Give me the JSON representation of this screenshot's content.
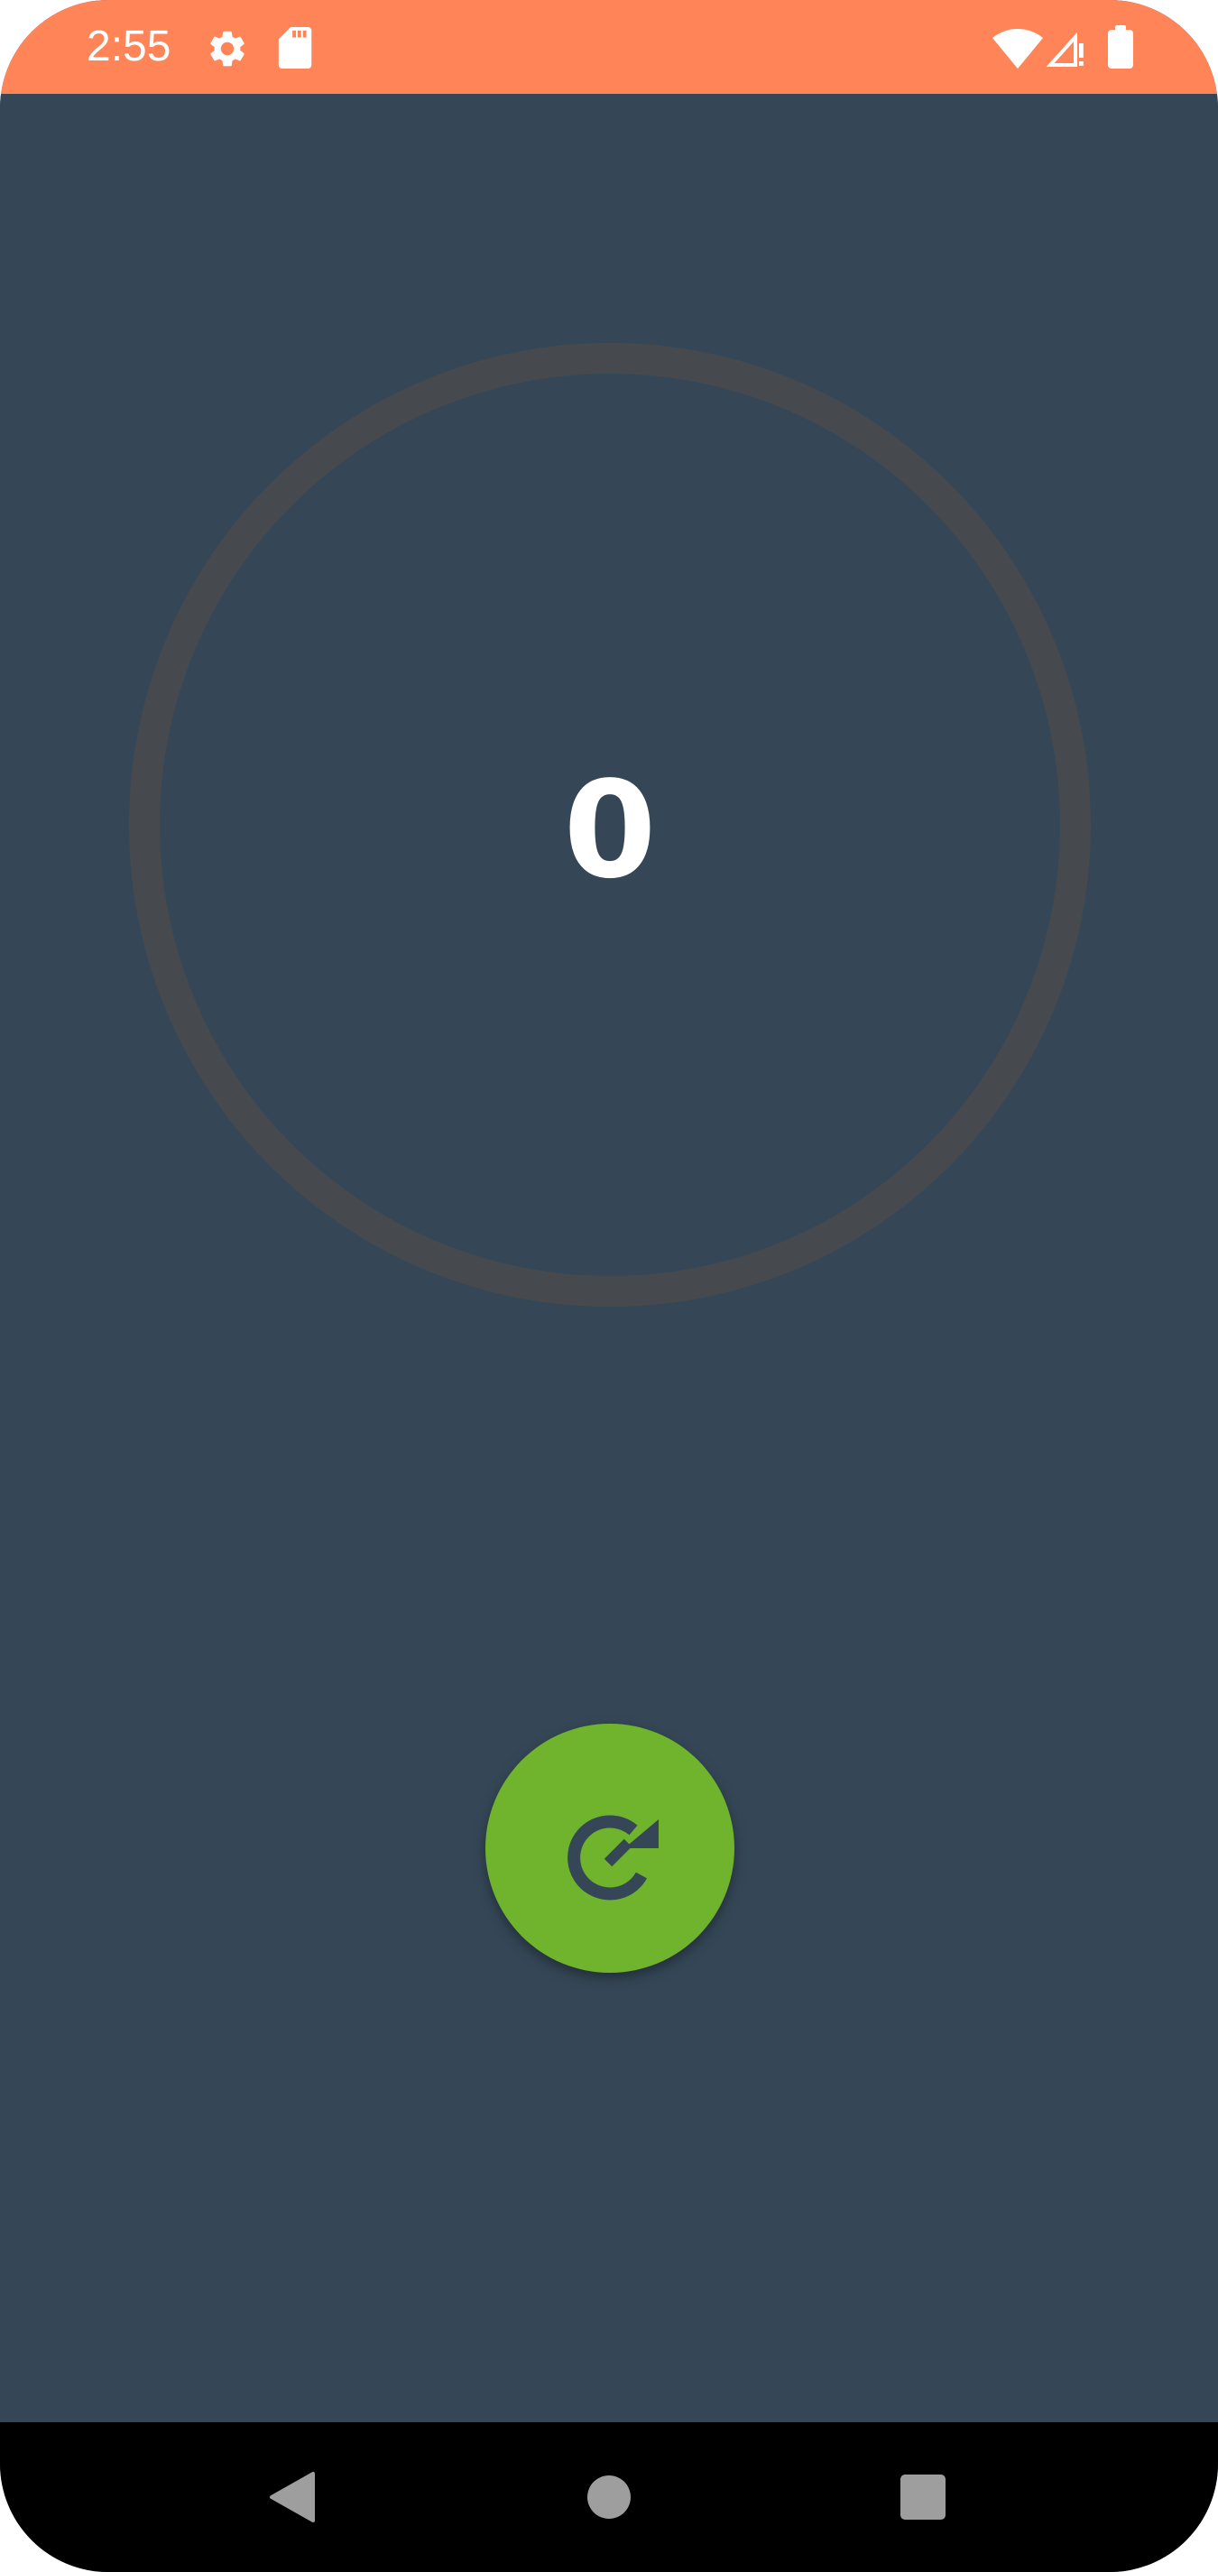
{
  "status_bar": {
    "time": "2:55",
    "background_color": "#ff8559",
    "icons": [
      "gear-icon",
      "sd-card-icon",
      "wifi-icon",
      "cell-signal-alert-icon",
      "battery-icon"
    ]
  },
  "main": {
    "background_color": "#354757",
    "counter_value": "0",
    "ring_color": "#464a4e"
  },
  "reset_button": {
    "icon": "refresh-icon",
    "color": "#6fb42c"
  },
  "nav_bar": {
    "buttons": [
      "back-icon",
      "home-icon",
      "recents-icon"
    ]
  }
}
